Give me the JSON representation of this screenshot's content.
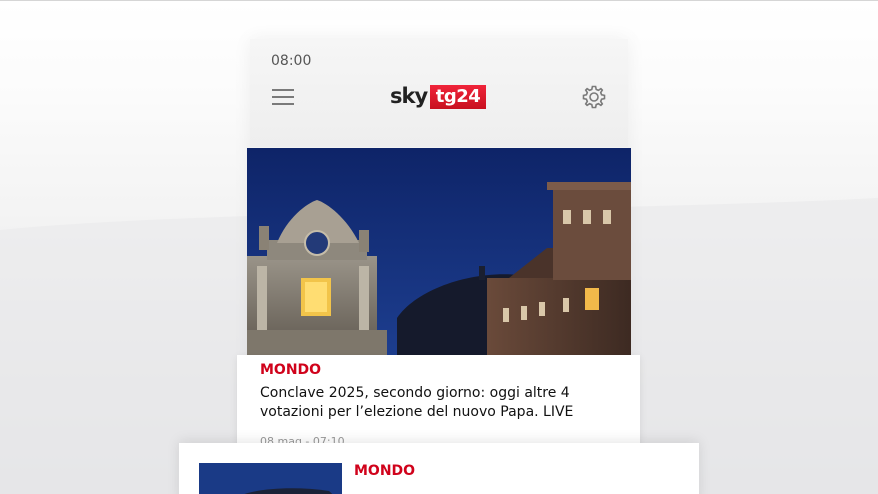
{
  "status_bar": {
    "time": "08:00"
  },
  "header": {
    "logo": {
      "sky": "sky",
      "tg": "tg24"
    },
    "menu_icon": "hamburger-menu-icon",
    "settings_icon": "gear-icon"
  },
  "hero": {
    "category": "MONDO",
    "headline": "Conclave 2025, secondo giorno: oggi altre 4 votazioni per l’elezione del nuovo Papa. LIVE",
    "date": "08 mag - 07:10"
  },
  "second_article": {
    "category": "MONDO",
    "headline": ""
  },
  "colors": {
    "brand_red": "#d0021b",
    "sky_blue": "#1c3b8f"
  }
}
